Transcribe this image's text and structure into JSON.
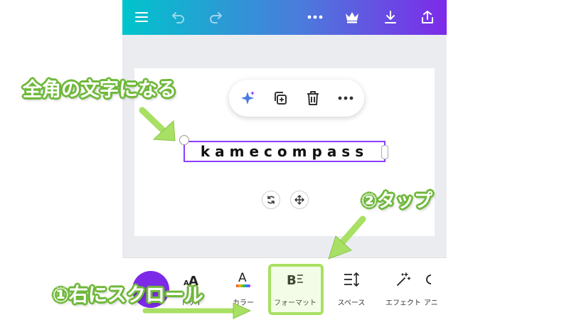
{
  "topbar": {
    "icons": [
      "menu-icon",
      "undo-icon",
      "redo-icon",
      "more-icon",
      "crown-icon",
      "download-icon",
      "share-icon"
    ]
  },
  "canvas": {
    "text_content": "kamecompass",
    "float_toolbar_icons": [
      "sparkle-icon",
      "duplicate-icon",
      "trash-icon",
      "more-icon"
    ]
  },
  "bottom_toolbar": {
    "items": [
      {
        "label": "トサイ",
        "icon": "font-size-icon"
      },
      {
        "label": "カラー",
        "icon": "text-color-icon"
      },
      {
        "label": "フォーマット",
        "icon": "format-icon"
      },
      {
        "label": "スペース",
        "icon": "spacing-icon"
      },
      {
        "label": "エフェクト",
        "icon": "effects-icon"
      },
      {
        "label": "アニ",
        "icon": "animate-icon"
      }
    ]
  },
  "annotations": {
    "full_width": "全角の文字になる",
    "tap": "②タップ",
    "scroll_right": "①右にスクロール"
  },
  "colors": {
    "brand_gradient_start": "#00c4cc",
    "brand_gradient_end": "#7d2ae8",
    "selection": "#8b3dff",
    "annotation_green": "#6fb83a"
  }
}
